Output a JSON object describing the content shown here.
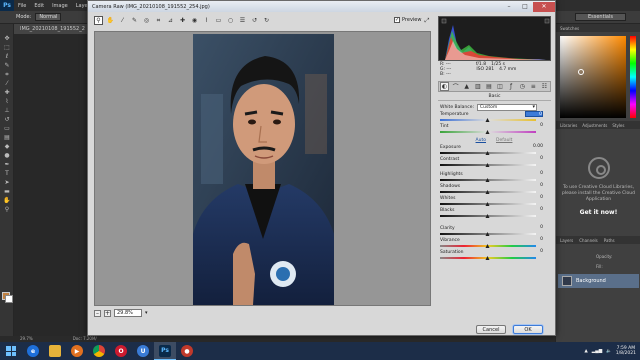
{
  "photoshop": {
    "logo": "Ps",
    "menu": [
      "File",
      "Edit",
      "Image",
      "Layer"
    ],
    "options_mode_label": "Mode:",
    "options_mode_value": "Normal",
    "workspace": "Essentials",
    "doc_tab": "IMG_20210108_191552_2",
    "status_zoom": "29.7%",
    "status_doc": "Doc: 7.20M/",
    "color_tab": "Swatches",
    "panel_tabs2": [
      "Libraries",
      "Adjustments",
      "Styles"
    ],
    "cc_text": "To use Creative Cloud Libraries, please install the Creative Cloud Application",
    "cc_link": "Get it now!",
    "layers_tabs": [
      "Layers",
      "Channels",
      "Paths"
    ],
    "opacity_label": "Opacity:",
    "fill_label": "Fill:",
    "layer_name": "Background"
  },
  "camera_raw": {
    "title": "Camera Raw (IMG_20210108_191552_254.jpg)",
    "preview_label": "Preview",
    "preview_checked": true,
    "zoom_value": "29.8%",
    "exif": {
      "r": "R: ---",
      "g": "G: ---",
      "b": "B: ---",
      "aperture": "f/1.8",
      "shutter": "1/25 s",
      "iso": "ISO 281",
      "focal": "4.7 mm"
    },
    "section_title": "Basic",
    "white_balance_label": "White Balance:",
    "white_balance_value": "Custom",
    "auto_label": "Auto",
    "default_label": "Default",
    "sliders": {
      "temperature": {
        "label": "Temperature",
        "value": "0"
      },
      "tint": {
        "label": "Tint",
        "value": "0"
      },
      "exposure": {
        "label": "Exposure",
        "value": "0.00"
      },
      "contrast": {
        "label": "Contrast",
        "value": "0"
      },
      "highlights": {
        "label": "Highlights",
        "value": "0"
      },
      "shadows": {
        "label": "Shadows",
        "value": "0"
      },
      "whites": {
        "label": "Whites",
        "value": "0"
      },
      "blacks": {
        "label": "Blacks",
        "value": "0"
      },
      "clarity": {
        "label": "Clarity",
        "value": "0"
      },
      "vibrance": {
        "label": "Vibrance",
        "value": "0"
      },
      "saturation": {
        "label": "Saturation",
        "value": "0"
      }
    },
    "cancel_label": "Cancel",
    "ok_label": "OK"
  },
  "taskbar": {
    "time": "7:59 AM",
    "date": "1/8/2021"
  },
  "colors": {
    "accent": "#3d7bd8",
    "taskbar": "#1c2d48",
    "dialog": "#d8d8d8"
  }
}
